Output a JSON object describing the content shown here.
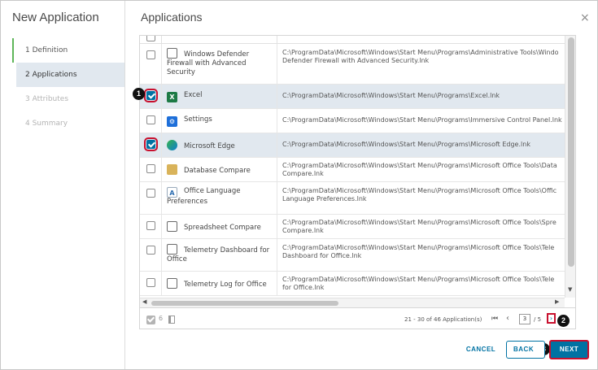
{
  "wizard": {
    "title": "New Application",
    "steps": [
      {
        "label": "1  Definition",
        "state": "done"
      },
      {
        "label": "2  Applications",
        "state": "active"
      },
      {
        "label": "3  Attributes",
        "state": "disabled"
      },
      {
        "label": "4  Summary",
        "state": "disabled"
      }
    ]
  },
  "panel": {
    "title": "Applications",
    "close_glyph": "×"
  },
  "grid": {
    "rows": [
      {
        "name": "Windows Defender Firewall with Advanced Security",
        "icon": "window-icon",
        "checked": false,
        "path": [
          "C:\\ProgramData\\Microsoft\\Windows\\Start Menu\\Programs\\Administrative Tools\\Windo",
          "Defender Firewall with Advanced Security.lnk"
        ]
      },
      {
        "name": "Excel",
        "icon": "excel-icon",
        "checked": true,
        "path": [
          "C:\\ProgramData\\Microsoft\\Windows\\Start Menu\\Programs\\Excel.lnk"
        ]
      },
      {
        "name": "Settings",
        "icon": "settings-icon",
        "checked": false,
        "path": [
          "C:\\ProgramData\\Microsoft\\Windows\\Start Menu\\Programs\\Immersive Control Panel.lnk"
        ]
      },
      {
        "name": "Microsoft Edge",
        "icon": "edge-icon",
        "checked": true,
        "path": [
          "C:\\ProgramData\\Microsoft\\Windows\\Start Menu\\Programs\\Microsoft Edge.lnk"
        ]
      },
      {
        "name": "Database Compare",
        "icon": "database-compare-icon",
        "checked": false,
        "path": [
          "C:\\ProgramData\\Microsoft\\Windows\\Start Menu\\Programs\\Microsoft Office Tools\\Data",
          "Compare.lnk"
        ]
      },
      {
        "name": "Office Language Preferences",
        "icon": "language-icon",
        "checked": false,
        "path": [
          "C:\\ProgramData\\Microsoft\\Windows\\Start Menu\\Programs\\Microsoft Office Tools\\Offic",
          "Language Preferences.lnk"
        ]
      },
      {
        "name": "Spreadsheet Compare",
        "icon": "spreadsheet-compare-icon",
        "checked": false,
        "path": [
          "C:\\ProgramData\\Microsoft\\Windows\\Start Menu\\Programs\\Microsoft Office Tools\\Spre",
          "Compare.lnk"
        ]
      },
      {
        "name": "Telemetry Dashboard for Office",
        "icon": "document-icon",
        "checked": false,
        "path": [
          "C:\\ProgramData\\Microsoft\\Windows\\Start Menu\\Programs\\Microsoft Office Tools\\Tele",
          "Dashboard for Office.lnk"
        ]
      },
      {
        "name": "Telemetry Log for Office",
        "icon": "document-search-icon",
        "checked": false,
        "path": [
          "C:\\ProgramData\\Microsoft\\Windows\\Start Menu\\Programs\\Microsoft Office Tools\\Tele",
          "for Office.lnk"
        ]
      }
    ],
    "footer": {
      "selected_count": "6",
      "range_text": "21 - 30 of 46 Application(s)",
      "first_glyph": "⏮",
      "prev_glyph": "‹",
      "current_page": "3",
      "total_text": "/ 5",
      "next_glyph": "›"
    }
  },
  "callouts": [
    "1",
    "2",
    "3"
  ],
  "buttons": {
    "cancel": "CANCEL",
    "back": "BACK",
    "next": "NEXT"
  },
  "colors": {
    "accent": "#0072a3",
    "highlight": "#c8102e",
    "selected_row": "#e1e8ef",
    "step_done": "#5fb65a"
  }
}
